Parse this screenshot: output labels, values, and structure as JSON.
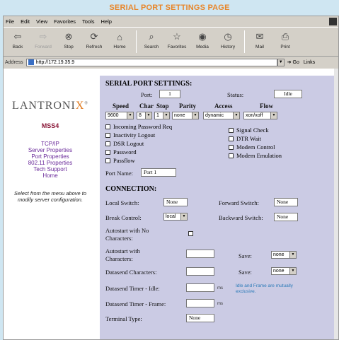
{
  "banner": {
    "title": "SERIAL PORT SETTINGS PAGE"
  },
  "menubar": {
    "items": [
      "File",
      "Edit",
      "View",
      "Favorites",
      "Tools",
      "Help"
    ]
  },
  "toolbar": {
    "buttons": [
      {
        "label": "Back",
        "icon": "back-arrow-icon",
        "enabled": true
      },
      {
        "label": "Forward",
        "icon": "forward-arrow-icon",
        "enabled": false
      },
      {
        "label": "Stop",
        "icon": "stop-icon",
        "enabled": true
      },
      {
        "label": "Refresh",
        "icon": "refresh-icon",
        "enabled": true
      },
      {
        "label": "Home",
        "icon": "home-icon",
        "enabled": true
      },
      {
        "label": "Search",
        "icon": "search-icon",
        "enabled": true
      },
      {
        "label": "Favorites",
        "icon": "favorites-icon",
        "enabled": true
      },
      {
        "label": "Media",
        "icon": "media-icon",
        "enabled": true
      },
      {
        "label": "History",
        "icon": "history-icon",
        "enabled": true
      },
      {
        "label": "Mail",
        "icon": "mail-icon",
        "enabled": true
      },
      {
        "label": "Print",
        "icon": "print-icon",
        "enabled": true
      }
    ]
  },
  "address": {
    "label": "Address",
    "url": "http://172.19.35.9",
    "go": "Go",
    "links": "Links"
  },
  "nav": {
    "logo_main": "LANTRONI",
    "logo_x": "X",
    "model": "MSS4",
    "links": [
      "TCP/IP",
      "Server Properties",
      "Port Properties",
      "802.11 Properties",
      "Tech Support",
      "Home"
    ],
    "help": "Select from the menu above to modify server configuration."
  },
  "serial": {
    "heading": "SERIAL PORT SETTINGS:",
    "port_label": "Port:",
    "port_value": "1",
    "status_label": "Status:",
    "status_value": "Idle",
    "col_speed": "Speed",
    "col_char": "Char",
    "col_stop": "Stop",
    "col_parity": "Parity",
    "col_access": "Access",
    "col_flow": "Flow",
    "speed_value": "9600",
    "char_value": "8",
    "stop_value": "1",
    "parity_value": "none",
    "access_value": "dynamic",
    "flow_value": "xon/xoff",
    "checks_left": [
      "Incoming Password Req",
      "Inactivity Logout",
      "DSR Logout",
      "Password",
      "Passflow"
    ],
    "checks_right": [
      "Signal Check",
      "DTR Wait",
      "Modem Control",
      "Modem Emulation"
    ],
    "portname_label": "Port Name:",
    "portname_value": "Port 1"
  },
  "connection": {
    "heading": "CONNECTION:",
    "local_switch_label": "Local Switch:",
    "local_switch_value": "None",
    "forward_switch_label": "Forward Switch:",
    "forward_switch_value": "None",
    "break_control_label": "Break Control:",
    "break_control_value": "local",
    "backward_switch_label": "Backward Switch:",
    "backward_switch_value": "None",
    "autostart_no_label_1": "Autostart with No",
    "autostart_no_label_2": "Characters:",
    "autostart_with_label_1": "Autostart with",
    "autostart_with_label_2": "Characters:",
    "autostart_with_value": "",
    "save1_label": "Save:",
    "save1_value": "none",
    "datasend_chars_label": "Datasend Characters:",
    "datasend_chars_value": "",
    "save2_label": "Save:",
    "save2_value": "none",
    "datasend_idle_label": "Datasend Timer - Idle:",
    "datasend_idle_value": "",
    "datasend_idle_unit": "ms",
    "datasend_frame_label": "Datasend Timer - Frame:",
    "datasend_frame_value": "",
    "datasend_frame_unit": "ms",
    "note": "Idle and Frame are mutually exclusive.",
    "terminal_label": "Terminal Type:",
    "terminal_value": "None"
  }
}
